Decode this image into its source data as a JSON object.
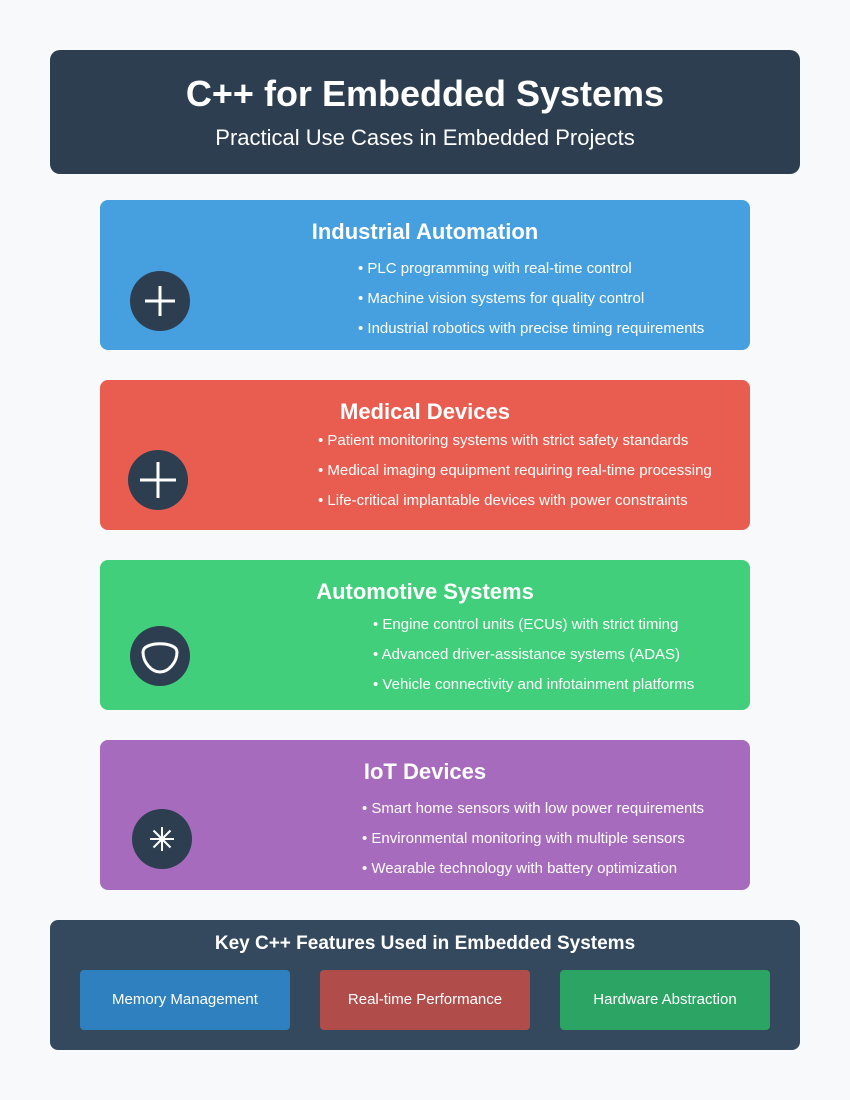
{
  "header": {
    "title": "C++ for Embedded Systems",
    "subtitle": "Practical Use Cases in Embedded Projects"
  },
  "cards": [
    {
      "title": "Industrial Automation",
      "icon": "plus-icon",
      "color": "#469fde",
      "items": [
        "PLC programming with real-time control",
        "Machine vision systems for quality control",
        "Industrial robotics with precise timing requirements"
      ]
    },
    {
      "title": "Medical Devices",
      "icon": "plus-icon",
      "color": "#e95d50",
      "items": [
        "Patient monitoring systems with strict safety standards",
        "Medical imaging equipment requiring real-time processing",
        "Life-critical implantable devices with power constraints"
      ]
    },
    {
      "title": "Automotive Systems",
      "icon": "steering-wheel-icon",
      "color": "#41cf7b",
      "items": [
        "Engine control units (ECUs) with strict timing",
        "Advanced driver-assistance systems (ADAS)",
        "Vehicle connectivity and infotainment platforms"
      ]
    },
    {
      "title": "IoT Devices",
      "icon": "asterisk-icon",
      "color": "#a66bbd",
      "items": [
        "Smart home sensors with low power requirements",
        "Environmental monitoring with multiple sensors",
        "Wearable technology with battery optimization"
      ]
    }
  ],
  "features": {
    "title": "Key C++ Features Used in Embedded Systems",
    "items": [
      {
        "label": "Memory Management",
        "color": "#2e80be"
      },
      {
        "label": "Real-time Performance",
        "color": "#b04c4a"
      },
      {
        "label": "Hardware Abstraction",
        "color": "#2ba464"
      }
    ]
  }
}
